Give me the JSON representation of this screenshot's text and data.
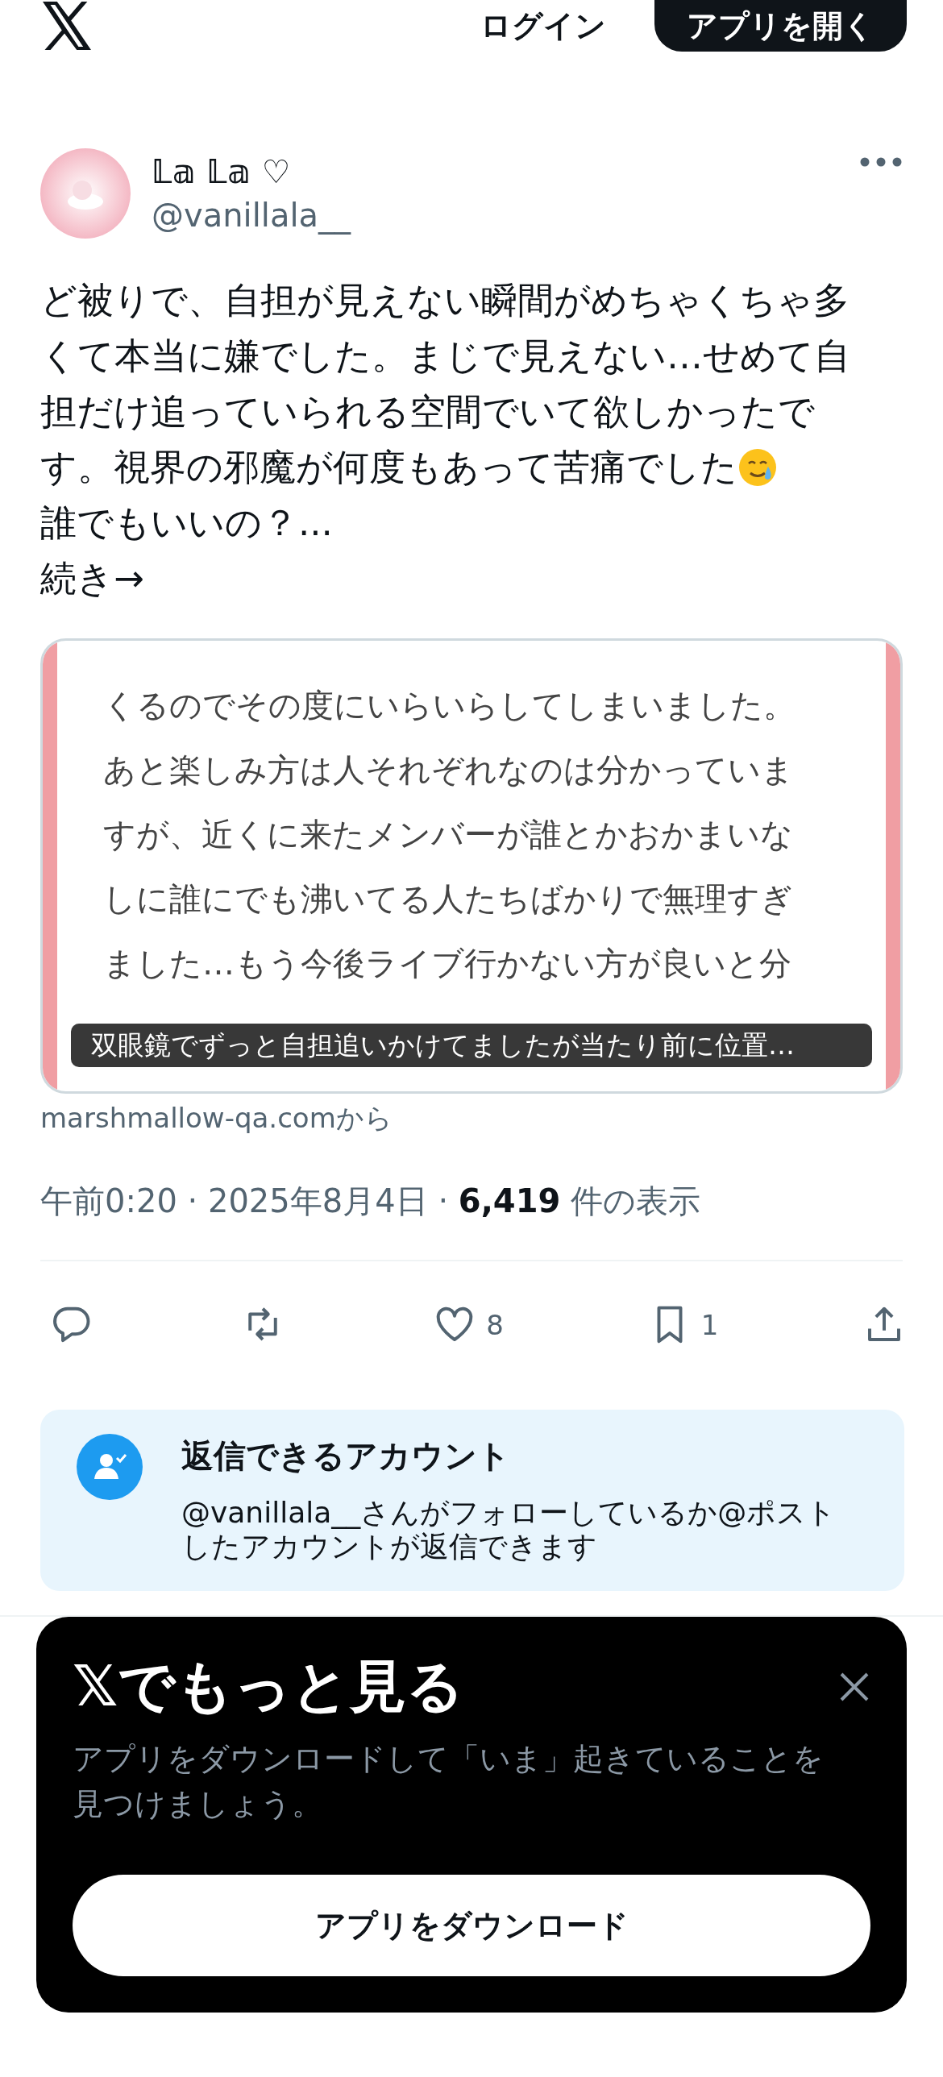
{
  "header": {
    "login": "ログイン",
    "open_app": "アプリを開く"
  },
  "post": {
    "name": "𝕃𝕒 𝕃𝕒 ♡",
    "handle": "@vanillala__",
    "lines": [
      "ど被りで、自担が見えない瞬間がめちゃくちゃ多",
      "くて本当に嫌でした。まじで見えない…せめて自",
      "担だけ追っていられる空間でいて欲しかったで",
      "す。視界の邪魔が何度もあって苦痛でした"
    ],
    "question": "誰でもいいの？...",
    "more": "続き→"
  },
  "card": {
    "lines": [
      "くるのでその度にいらいらしてしまいました。",
      "あと楽しみ方は人それぞれなのは分かっていま",
      "すが、近くに来たメンバーが誰とかおかまいな",
      "しに誰にでも沸いてる人たちばかりで無理すぎ",
      "ました…もう今後ライブ行かない方が良いと分"
    ],
    "caption": "双眼鏡でずっと自担追いかけてましたが当たり前に位置…",
    "source": "marshmallow-qa.comから"
  },
  "meta": "午前0:20 · 2025年8月4日 · **6,419** 件の表示",
  "actions": [
    {
      "kind": "reply"
    },
    {
      "kind": "repost"
    },
    {
      "kind": "like",
      "count": "8"
    },
    {
      "kind": "bookmark",
      "count": "1"
    },
    {
      "kind": "share"
    }
  ],
  "reply_info": {
    "title": "返信できるアカウント",
    "text": "@vanillala__さんがフォローしているか@ポストしたアカウントが返信できます"
  },
  "banner": {
    "title": "𝕏でもっと見る",
    "text": "アプリをダウンロードして「いま」起きていることを見つけましょう。",
    "button": "アプリをダウンロード"
  }
}
